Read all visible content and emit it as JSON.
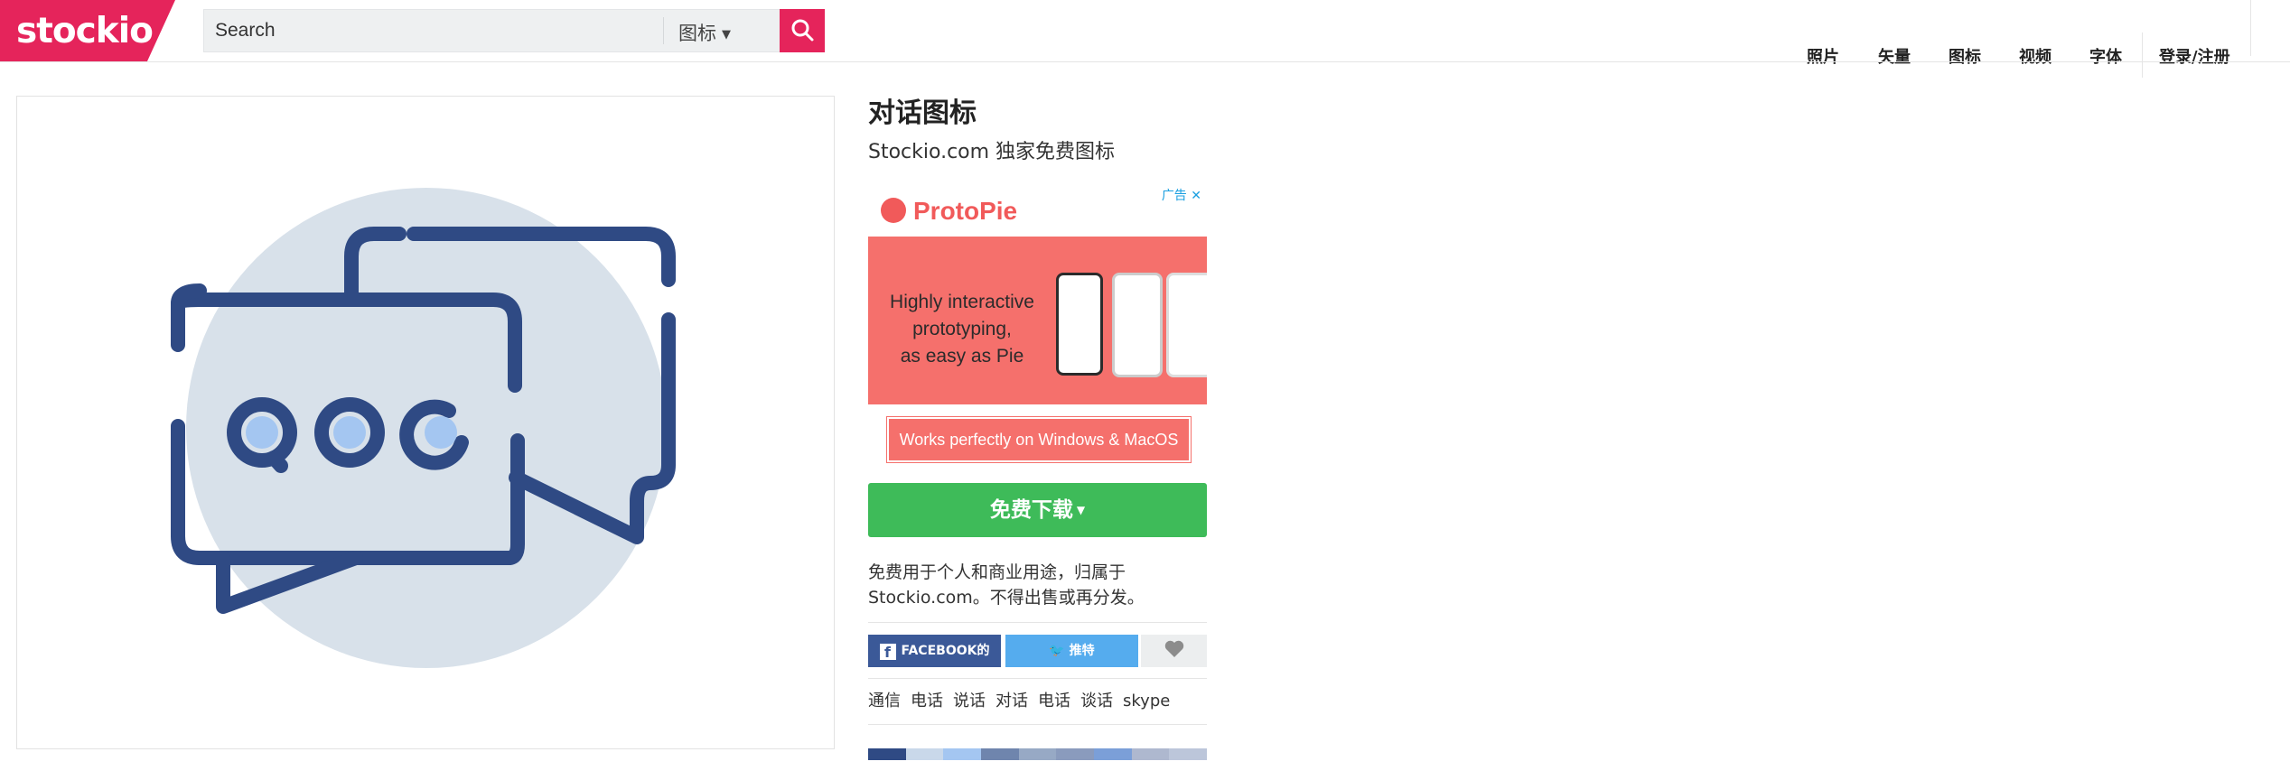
{
  "header": {
    "logo_text": "stockio",
    "search_placeholder": "Search",
    "search_type": "图标",
    "nav": [
      "照片",
      "矢量",
      "图标",
      "视频",
      "字体",
      "登录/注册"
    ]
  },
  "icon_title": "对话图标",
  "icon_subtitle": "Stockio.com 独家免费图标",
  "ad": {
    "label": "广告",
    "brand": "ProtoPie",
    "headline_lines": [
      "Highly interactive",
      "prototyping,",
      "as easy as Pie"
    ],
    "cta": "Works perfectly on Windows & MacOS"
  },
  "download": {
    "label": "免费下载"
  },
  "license_text": "免费用于个人和商业用途，归属于 Stockio.com。不得出售或再分发。",
  "share": {
    "facebook": "FACEBOOK的",
    "twitter": "推特"
  },
  "tags": [
    "通信",
    "电话",
    "说话",
    "对话",
    "电话",
    "谈话",
    "skype"
  ],
  "palette": [
    "#2f4a84",
    "#c9d8ea",
    "#a4c6f1",
    "#6f85ad",
    "#97a9c5",
    "#8a9bbd",
    "#7b9fd8",
    "#aeb8cf",
    "#bcc6da"
  ],
  "colors": {
    "brand": "#e5245b",
    "download": "#3ebb59",
    "icon_stroke": "#2f4a84",
    "icon_fill": "#a4c6f1",
    "icon_bg": "#d8e1ea"
  }
}
